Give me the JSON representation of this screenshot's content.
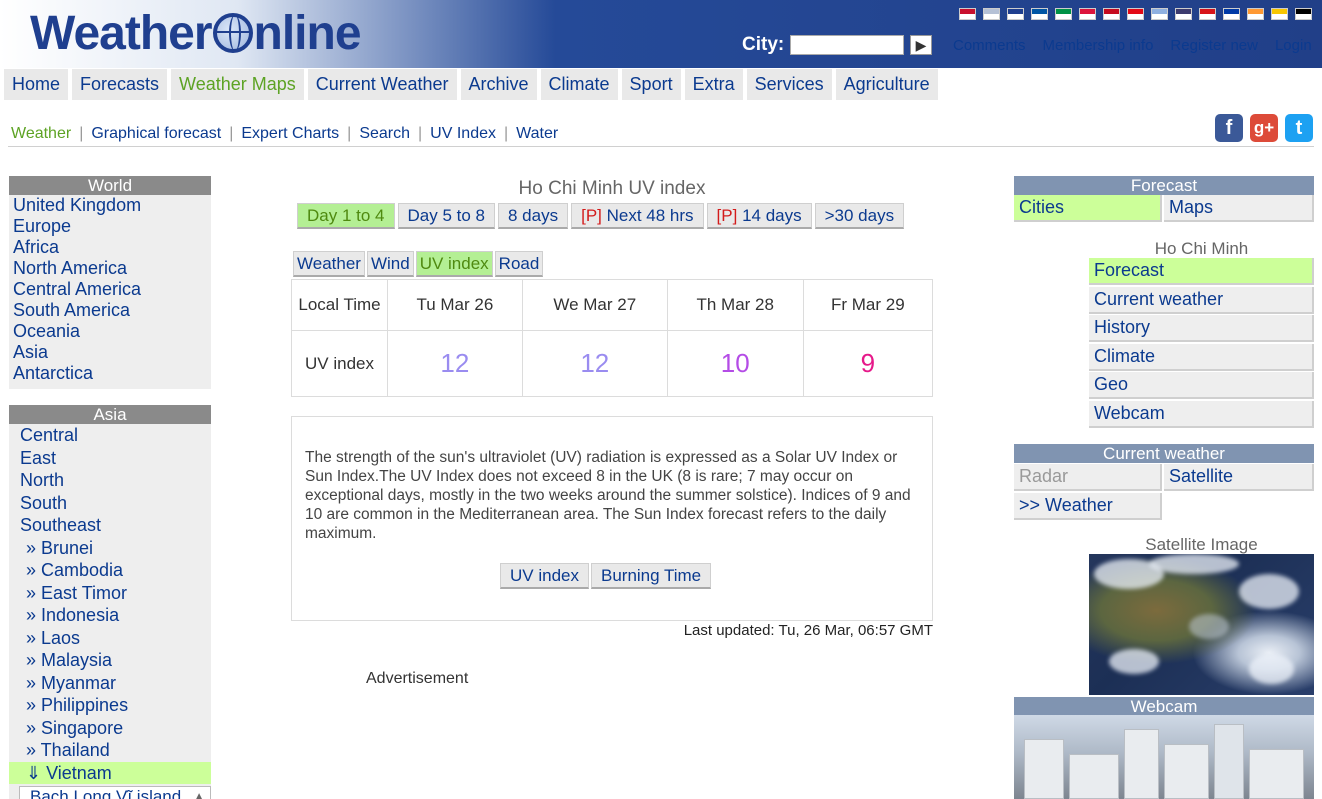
{
  "header": {
    "logo_left": "Weather",
    "logo_right": "nline",
    "city_label": "City:",
    "city_placeholder": "",
    "go_glyph": "▶",
    "top_links": [
      "Comments",
      "Membership info",
      "Register new",
      "Login"
    ],
    "flag_colors": [
      "#c8102e",
      "#b5c1d6",
      "#1f3f8f",
      "#0055a4",
      "#009246",
      "#dc143c",
      "#c60b1e",
      "#e30a17",
      "#8fb0e0",
      "#3c3b6e",
      "#d7141a",
      "#0039a6",
      "#ff9933",
      "#f7c600",
      "#000000"
    ]
  },
  "mainnav": {
    "items": [
      "Home",
      "Forecasts",
      "Weather Maps",
      "Current Weather",
      "Archive",
      "Climate",
      "Sport",
      "Extra",
      "Services",
      "Agriculture"
    ],
    "active": "Weather Maps"
  },
  "subnav": {
    "items": [
      "Weather",
      "Graphical forecast",
      "Expert Charts",
      "Search",
      "UV Index",
      "Water"
    ],
    "active": "Weather"
  },
  "social": {
    "facebook": "f",
    "googleplus": "g+",
    "twitter": "t"
  },
  "left": {
    "world_title": "World",
    "world_links": [
      "United Kingdom",
      "Europe",
      "Africa",
      "North America",
      "Central America",
      "South America",
      "Oceania",
      "Asia",
      "Antarctica"
    ],
    "asia_title": "Asia",
    "asia_regions": [
      "Central",
      "East",
      "North",
      "South",
      "Southeast"
    ],
    "asia_countries": [
      "» Brunei",
      "» Cambodia",
      "» East Timor",
      "» Indonesia",
      "» Laos",
      "» Malaysia",
      "» Myanmar",
      "» Philippines",
      "» Singapore",
      "» Thailand"
    ],
    "current_country": "⇓ Vietnam",
    "dropdown_value": "Bach Long Vĩ island"
  },
  "center": {
    "title": "Ho Chi Minh UV index",
    "day_tabs": [
      {
        "prefix": "",
        "label": "Day 1 to 4",
        "active": true
      },
      {
        "prefix": "",
        "label": "Day 5 to 8",
        "active": false
      },
      {
        "prefix": "",
        "label": "8 days",
        "active": false
      },
      {
        "prefix": "[P]",
        "label": " Next 48 hrs",
        "active": false
      },
      {
        "prefix": "[P]",
        "label": " 14 days",
        "active": false
      },
      {
        "prefix": "",
        "label": ">30 days",
        "active": false
      }
    ],
    "type_tabs": [
      "Weather",
      "Wind",
      "UV index",
      "Road"
    ],
    "type_active": "UV index",
    "table": {
      "row1_label": "Local Time",
      "row2_label": "UV index",
      "days": [
        "Tu Mar 26",
        "We Mar 27",
        "Th Mar 28",
        "Fr Mar 29"
      ],
      "uv": [
        "12",
        "12",
        "10",
        "9"
      ],
      "uv_colors": [
        "#9a8cf0",
        "#9a8cf0",
        "#b44ce6",
        "#e6198a"
      ]
    },
    "info_text": "The strength of the sun's ultraviolet (UV) radiation is expressed as a Solar UV Index or Sun Index.The UV Index does not exceed 8 in the UK (8 is rare; 7 may occur on exceptional days, mostly in the two weeks around the summer solstice). Indices of 9 and 10 are common in the Mediterranean area. The Sun Index forecast refers to the daily maximum.",
    "info_buttons": [
      "UV index",
      "Burning Time"
    ],
    "last_updated": "Last updated: Tu, 26 Mar, 06:57 GMT",
    "advert": "Advertisement"
  },
  "right": {
    "forecast_title": "Forecast",
    "forecast_tabs": [
      "Cities",
      "Maps"
    ],
    "city_name": "Ho Chi Minh",
    "city_links": [
      "Forecast",
      "Current weather",
      "History",
      "Climate",
      "Geo",
      "Webcam"
    ],
    "current_title": "Current weather",
    "current_links": [
      "Radar",
      "Satellite",
      ">> Weather"
    ],
    "satellite_label": "Satellite Image",
    "webcam_title": "Webcam"
  }
}
